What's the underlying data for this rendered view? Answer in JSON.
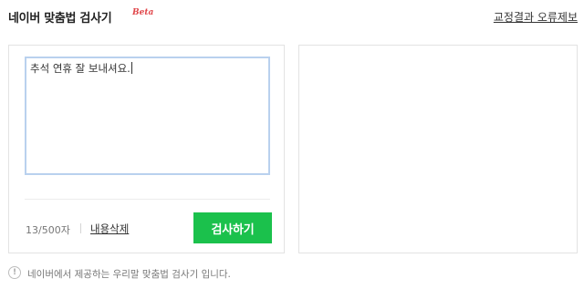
{
  "header": {
    "title": "네이버 맞춤법 검사기",
    "beta": "Beta",
    "report_link": "교정결과 오류제보"
  },
  "editor": {
    "text": "추석 연휴 잘 보내셔요.",
    "counter": "13/500자",
    "clear_label": "내용삭제",
    "check_button": "검사하기"
  },
  "footer": {
    "info_icon_glyph": "!",
    "notice": "네이버에서 제공하는 우리말 맞춤법 검사기 입니다."
  },
  "colors": {
    "accent_green": "#1bc14c",
    "beta_red": "#e0464a",
    "input_border": "#b9d1ee"
  }
}
